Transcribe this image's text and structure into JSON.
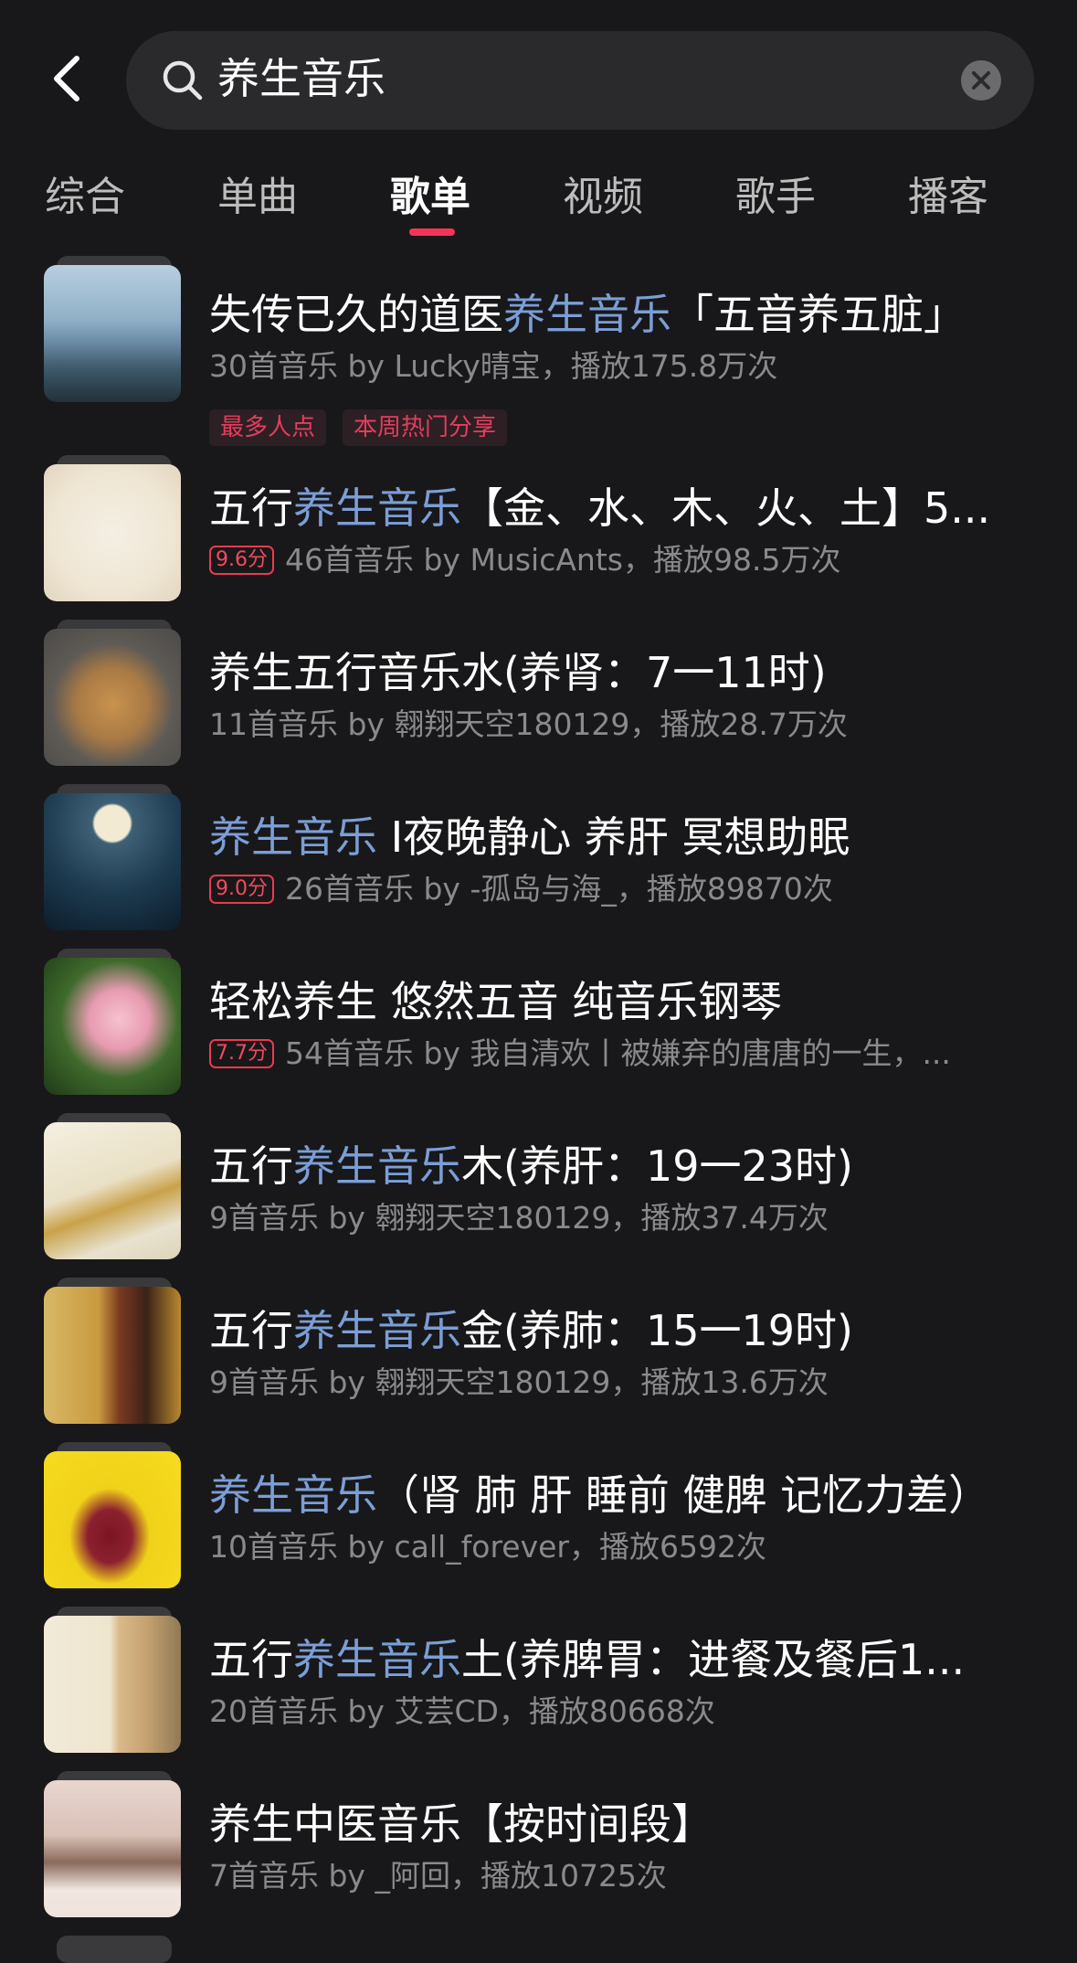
{
  "search": {
    "query": "养生音乐"
  },
  "tabs": [
    {
      "label": "综合"
    },
    {
      "label": "单曲"
    },
    {
      "label": "歌单",
      "active": true
    },
    {
      "label": "视频"
    },
    {
      "label": "歌手"
    },
    {
      "label": "播客"
    }
  ],
  "colors": {
    "background": "#18181a",
    "highlight": "#7c9ed6",
    "accent": "#f5345a",
    "subtext": "#8a8a8c"
  },
  "playlists": [
    {
      "title_parts": [
        "失传已久的道医",
        "养生音乐",
        "「五音养五脏」"
      ],
      "meta": "30首音乐  by Lucky晴宝，播放175.8万次",
      "score": "",
      "tags": [
        "最多人点",
        "本周热门分享"
      ]
    },
    {
      "title_parts": [
        "五行",
        "养生音乐",
        "【金、水、木、火、土】5..."
      ],
      "meta": "46首音乐  by MusicAnts，播放98.5万次",
      "score": "9.6分"
    },
    {
      "title_parts": [
        "养生五行音乐水(养肾：7一11时)",
        "",
        ""
      ],
      "meta": "11首音乐  by 翱翔天空180129，播放28.7万次",
      "score": ""
    },
    {
      "title_parts": [
        "",
        "养生音乐",
        " I夜晚静心 养肝 冥想助眠"
      ],
      "meta": "26首音乐  by -孤岛与海_，播放89870次",
      "score": "9.0分"
    },
    {
      "title_parts": [
        "轻松养生 悠然五音 纯音乐钢琴",
        "",
        ""
      ],
      "meta": "54首音乐  by 我自清欢丨被嫌弃的唐唐的一生，...",
      "score": "7.7分"
    },
    {
      "title_parts": [
        "五行",
        "养生音乐",
        "木(养肝：19一23时)"
      ],
      "meta": "9首音乐  by 翱翔天空180129，播放37.4万次",
      "score": ""
    },
    {
      "title_parts": [
        "五行",
        "养生音乐",
        "金(养肺：15一19时)"
      ],
      "meta": "9首音乐  by 翱翔天空180129，播放13.6万次",
      "score": ""
    },
    {
      "title_parts": [
        "",
        "养生音乐",
        "（肾 肺 肝 睡前 健脾 记忆力差）"
      ],
      "meta": "10首音乐  by call_forever，播放6592次",
      "score": ""
    },
    {
      "title_parts": [
        "五行",
        "养生音乐",
        "土(养脾胃：进餐及餐后1..."
      ],
      "meta": "20首音乐  by 艾芸CD，播放80668次",
      "score": ""
    },
    {
      "title_parts": [
        "养生中医音乐【按时间段】",
        "",
        ""
      ],
      "meta": "7首音乐  by _阿回，播放10725次",
      "score": ""
    }
  ]
}
